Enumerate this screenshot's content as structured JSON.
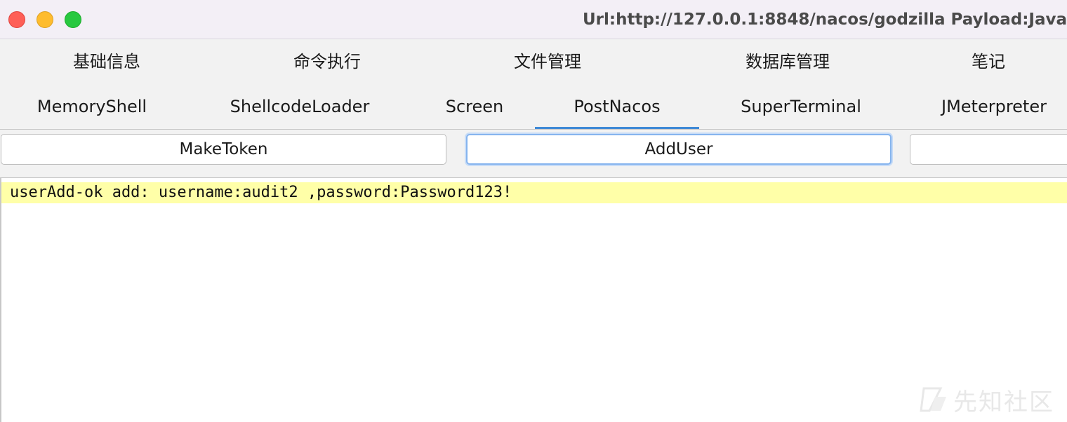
{
  "window": {
    "title": "Url:http://127.0.0.1:8848/nacos/godzilla Payload:Java"
  },
  "tabs": {
    "row1": [
      "基础信息",
      "命令执行",
      "文件管理",
      "数据库管理",
      "笔记"
    ],
    "row2": [
      "MemoryShell",
      "ShellcodeLoader",
      "Screen",
      "PostNacos",
      "SuperTerminal",
      "JMeterpreter"
    ],
    "selected": "PostNacos"
  },
  "buttons": {
    "make_token": "MakeToken",
    "add_user": "AddUser",
    "third": ""
  },
  "output": {
    "line1": "userAdd-ok add: username:audit2 ,password:Password123!"
  },
  "watermark": {
    "text": "先知社区"
  },
  "colors": {
    "accent": "#3f8ad6",
    "highlight": "#ffffa8",
    "close": "#fe5f57",
    "minimize": "#febc2e",
    "zoom": "#28c840"
  }
}
